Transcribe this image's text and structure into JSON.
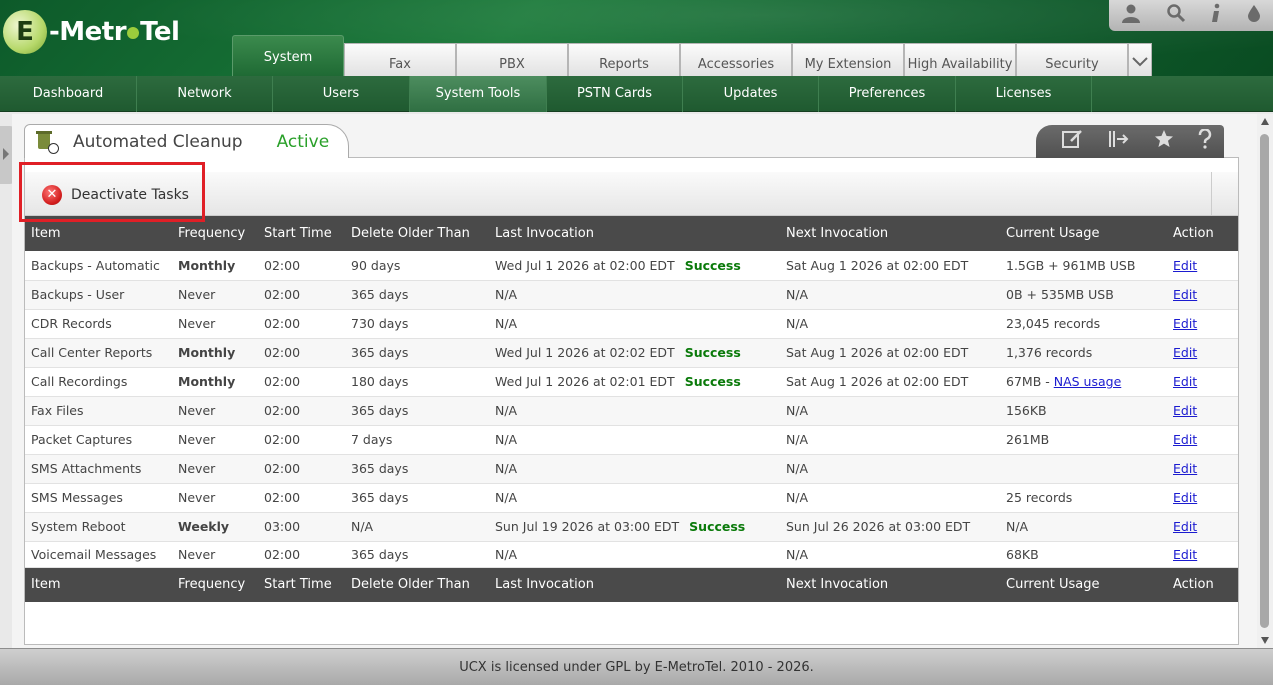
{
  "logo": {
    "prefix": "E",
    "text_left": "-Metr",
    "text_right": "Tel"
  },
  "main_tabs": [
    "System",
    "Fax",
    "PBX",
    "Reports",
    "Accessories",
    "My Extension",
    "High Availability",
    "Security"
  ],
  "sub_nav": [
    "Dashboard",
    "Network",
    "Users",
    "System Tools",
    "PSTN Cards",
    "Updates",
    "Preferences",
    "Licenses"
  ],
  "panel": {
    "title": "Automated Cleanup",
    "status": "Active"
  },
  "toolbar": {
    "deactivate_label": "Deactivate Tasks"
  },
  "table": {
    "headers": [
      "Item",
      "Frequency",
      "Start Time",
      "Delete Older Than",
      "Last Invocation",
      "Next Invocation",
      "Current Usage",
      "Action"
    ],
    "rows": [
      {
        "item": "Backups - Automatic",
        "frequency": "Monthly",
        "start": "02:00",
        "older": "90 days",
        "last": "Wed Jul 1 2026 at 02:00 EDT",
        "last_status": "Success",
        "next": "Sat Aug 1 2026 at 02:00 EDT",
        "usage": "1.5GB + 961MB USB",
        "usage_link": "",
        "action": "Edit"
      },
      {
        "item": "Backups - User",
        "frequency": "Never",
        "start": "02:00",
        "older": "365 days",
        "last": "N/A",
        "last_status": "",
        "next": "N/A",
        "usage": "0B + 535MB USB",
        "usage_link": "",
        "action": "Edit"
      },
      {
        "item": "CDR Records",
        "frequency": "Never",
        "start": "02:00",
        "older": "730 days",
        "last": "N/A",
        "last_status": "",
        "next": "N/A",
        "usage": "23,045 records",
        "usage_link": "",
        "action": "Edit"
      },
      {
        "item": "Call Center Reports",
        "frequency": "Monthly",
        "start": "02:00",
        "older": "365 days",
        "last": "Wed Jul 1 2026 at 02:02 EDT",
        "last_status": "Success",
        "next": "Sat Aug 1 2026 at 02:00 EDT",
        "usage": "1,376 records",
        "usage_link": "",
        "action": "Edit"
      },
      {
        "item": "Call Recordings",
        "frequency": "Monthly",
        "start": "02:00",
        "older": "180 days",
        "last": "Wed Jul 1 2026 at 02:01 EDT",
        "last_status": "Success",
        "next": "Sat Aug 1 2026 at 02:00 EDT",
        "usage": "67MB - ",
        "usage_link": "NAS usage",
        "action": "Edit"
      },
      {
        "item": "Fax Files",
        "frequency": "Never",
        "start": "02:00",
        "older": "365 days",
        "last": "N/A",
        "last_status": "",
        "next": "N/A",
        "usage": "156KB",
        "usage_link": "",
        "action": "Edit"
      },
      {
        "item": "Packet Captures",
        "frequency": "Never",
        "start": "02:00",
        "older": "7 days",
        "last": "N/A",
        "last_status": "",
        "next": "N/A",
        "usage": "261MB",
        "usage_link": "",
        "action": "Edit"
      },
      {
        "item": "SMS Attachments",
        "frequency": "Never",
        "start": "02:00",
        "older": "365 days",
        "last": "N/A",
        "last_status": "",
        "next": "N/A",
        "usage": "",
        "usage_link": "",
        "action": "Edit"
      },
      {
        "item": "SMS Messages",
        "frequency": "Never",
        "start": "02:00",
        "older": "365 days",
        "last": "N/A",
        "last_status": "",
        "next": "N/A",
        "usage": "25 records",
        "usage_link": "",
        "action": "Edit"
      },
      {
        "item": "System Reboot",
        "frequency": "Weekly",
        "start": "03:00",
        "older": "N/A",
        "last": "Sun Jul 19 2026 at 03:00 EDT",
        "last_status": "Success",
        "next": "Sun Jul 26 2026 at 03:00 EDT",
        "usage": "N/A",
        "usage_link": "",
        "action": "Edit"
      },
      {
        "item": "Voicemail Messages",
        "frequency": "Never",
        "start": "02:00",
        "older": "365 days",
        "last": "N/A",
        "last_status": "",
        "next": "N/A",
        "usage": "68KB",
        "usage_link": "",
        "action": "Edit"
      }
    ]
  },
  "footer": "UCX is licensed under GPL by E-MetroTel. 2010 - 2026.",
  "colors": {
    "brand_green": "#1b7a3a",
    "status_active": "#2aa02a",
    "success": "#0a7a0a",
    "highlight": "#e01f26",
    "link": "#1b1bd0"
  }
}
